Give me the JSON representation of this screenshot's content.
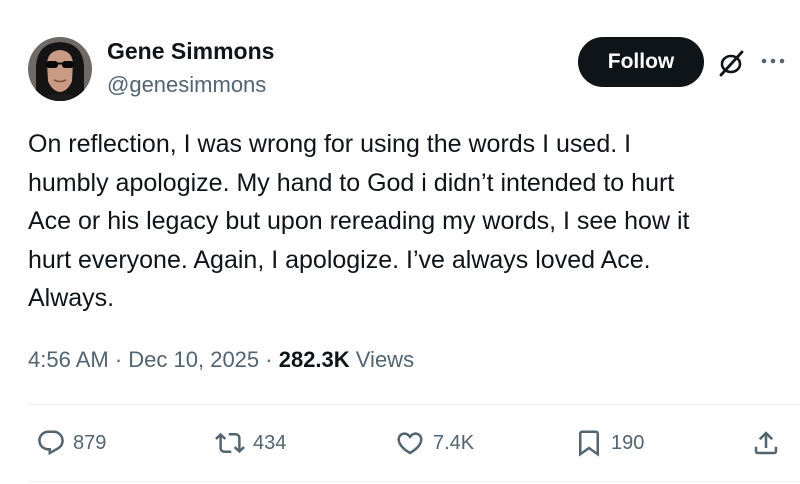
{
  "author": {
    "display_name": "Gene Simmons",
    "handle": "@genesimmons",
    "avatar_icon": "avatar-photo"
  },
  "follow_label": "Follow",
  "icons": {
    "grok": "grok-icon",
    "more": "more-icon"
  },
  "body_lines": [
    "On reflection, I was wrong for using the words I used. I",
    "humbly apologize. My hand to God i didn’t intended to hurt",
    "Ace or his legacy but upon rereading my words, I see how it",
    "hurt everyone. Again, I apologize. I’ve always loved Ace.",
    "Always."
  ],
  "meta": {
    "time": "4:56 AM",
    "sep1": " · ",
    "date": "Dec 10, 2025",
    "sep2": " · ",
    "views_count": "282.3K",
    "views_label": " Views"
  },
  "actions": {
    "replies": "879",
    "reposts": "434",
    "likes": "7.4K",
    "bookmarks": "190"
  },
  "colors": {
    "text": "#0f1419",
    "secondary": "#536471",
    "follow_bg": "#0f1419",
    "divider": "#eff3f4"
  }
}
